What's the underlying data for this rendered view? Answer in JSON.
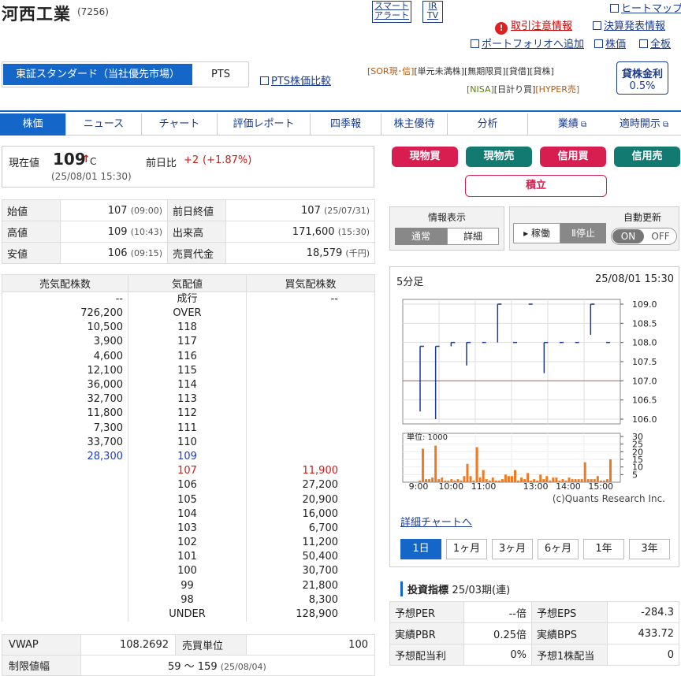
{
  "header": {
    "name": "河西工業",
    "code": "(7256)",
    "smart_alert": [
      "スマート",
      "アラート"
    ],
    "irtv": [
      "IR",
      "TV"
    ],
    "heatmap": "ヒートマップ",
    "caution": "取引注意情報",
    "earnings": "決算発表情報",
    "portfolio_add": "ポートフォリオへ追加",
    "stock_price": "株価",
    "full_board": "全板"
  },
  "market": {
    "active": "東証スタンダード（当社優先市場）",
    "pts": "PTS",
    "pts_compare": "PTS株価比較"
  },
  "tags": {
    "row1": [
      "[SOR現･信]",
      "[単元未満株]",
      "[無期限買]",
      "[貸借]",
      "[貸株]"
    ],
    "row2": [
      "[NISA]",
      "[日計り買]",
      "[HYPER売]"
    ]
  },
  "lending": {
    "label": "貸株金利",
    "rate": "0.5%"
  },
  "nav": [
    "株価",
    "ニュース",
    "チャート",
    "評価レポート",
    "四季報",
    "株主優待",
    "分析",
    "業績",
    "適時開示"
  ],
  "price": {
    "label": "現在値",
    "value": "109",
    "arrow": "↑",
    "flag": "C",
    "time": "(25/08/01 15:30)",
    "change_label": "前日比",
    "change": "+2",
    "change_pct": "(+1.87%)"
  },
  "ohlc": [
    {
      "l1": "始値",
      "v1": "107",
      "t1": "(09:00)",
      "l2": "前日終値",
      "v2": "107",
      "t2": "(25/07/31)"
    },
    {
      "l1": "高値",
      "v1": "109",
      "t1": "(10:43)",
      "l2": "出来高",
      "v2": "171,600",
      "t2": "(15:30)"
    },
    {
      "l1": "安値",
      "v1": "106",
      "t1": "(09:15)",
      "l2": "売買代金",
      "v2": "18,579",
      "t2": "(千円)"
    }
  ],
  "board": {
    "headers": [
      "売気配株数",
      "気配値",
      "買気配株数"
    ],
    "rows": [
      {
        "ask": "--",
        "price": "成行",
        "bid": "--"
      },
      {
        "ask": "726,200",
        "price": "OVER",
        "bid": ""
      },
      {
        "ask": "10,500",
        "price": "118",
        "bid": ""
      },
      {
        "ask": "3,900",
        "price": "117",
        "bid": ""
      },
      {
        "ask": "4,600",
        "price": "116",
        "bid": ""
      },
      {
        "ask": "12,100",
        "price": "115",
        "bid": ""
      },
      {
        "ask": "36,000",
        "price": "114",
        "bid": ""
      },
      {
        "ask": "32,700",
        "price": "113",
        "bid": ""
      },
      {
        "ask": "11,800",
        "price": "112",
        "bid": ""
      },
      {
        "ask": "7,300",
        "price": "111",
        "bid": ""
      },
      {
        "ask": "33,700",
        "price": "110",
        "bid": ""
      },
      {
        "ask": "28,300",
        "price": "109",
        "bid": ""
      },
      {
        "ask": "",
        "price": "107",
        "bid": "11,900"
      },
      {
        "ask": "",
        "price": "106",
        "bid": "27,200"
      },
      {
        "ask": "",
        "price": "105",
        "bid": "20,900"
      },
      {
        "ask": "",
        "price": "104",
        "bid": "16,000"
      },
      {
        "ask": "",
        "price": "103",
        "bid": "6,700"
      },
      {
        "ask": "",
        "price": "102",
        "bid": "11,200"
      },
      {
        "ask": "",
        "price": "101",
        "bid": "50,400"
      },
      {
        "ask": "",
        "price": "100",
        "bid": "30,700"
      },
      {
        "ask": "",
        "price": "99",
        "bid": "21,800"
      },
      {
        "ask": "",
        "price": "98",
        "bid": "8,300"
      },
      {
        "ask": "",
        "price": "UNDER",
        "bid": "128,900"
      }
    ],
    "best_ask_color": "#1a3bd0",
    "best_bid_color": "#d01a1a"
  },
  "misc": {
    "vwap_label": "VWAP",
    "vwap": "108.2692",
    "unit_label": "売買単位",
    "unit": "100",
    "limit_label": "制限値幅",
    "limit": "59 ～ 159",
    "limit_date": "(25/08/04)"
  },
  "actions": {
    "spot_buy": "現物買",
    "spot_sell": "現物売",
    "margin_buy": "信用買",
    "margin_sell": "信用売",
    "accumulate": "積立"
  },
  "info_display": {
    "title": "情報表示",
    "normal": "通常",
    "detail": "詳細"
  },
  "auto_update": {
    "title": "自動更新",
    "run": "稼働",
    "stop": "停止",
    "on": "ON",
    "off": "OFF"
  },
  "chart": {
    "interval": "5分足",
    "datetime": "25/08/01 15:30",
    "credit": "(c)Quants Research Inc.",
    "detail_link": "詳細チャートへ",
    "ranges": [
      "1日",
      "1ヶ月",
      "3ヶ月",
      "6ヶ月",
      "1年",
      "3年"
    ]
  },
  "chart_data": {
    "type": "line",
    "price_ticks": [
      "109.0",
      "108.5",
      "108.0",
      "107.5",
      "107.0",
      "106.5",
      "106.0"
    ],
    "ylim": [
      106.0,
      109.0
    ],
    "prev_close": 107.0,
    "volume_label": "単位: 1000",
    "volume_ticks": [
      "30",
      "25",
      "20",
      "15",
      "10",
      "5"
    ],
    "volume_ylim": [
      0,
      30
    ],
    "x_ticks": [
      "9:00",
      "10:00",
      "11:00",
      "13:00",
      "14:00",
      "15:00"
    ],
    "price_segments": [
      [
        106.2,
        107.9
      ],
      [
        106.0,
        107.9
      ],
      [
        107.9,
        108.0
      ],
      [
        107.4,
        108.0
      ],
      [
        108.0,
        108.0
      ],
      [
        108.0,
        109.0
      ],
      [
        108.0,
        108.0
      ],
      [
        109.0,
        109.0
      ],
      [
        107.2,
        108.0
      ],
      [
        108.0,
        108.0
      ],
      [
        108.0,
        108.0
      ],
      [
        108.2,
        109.0
      ],
      [
        108.0,
        108.0
      ]
    ],
    "volumes": [
      1,
      22,
      2,
      2,
      3,
      24,
      2,
      3,
      1,
      1,
      2,
      1,
      2,
      1,
      4,
      12,
      4,
      1,
      23,
      3,
      8,
      2,
      1,
      3,
      1,
      1,
      2,
      5,
      4,
      4,
      8,
      1,
      3,
      2,
      6,
      1,
      2,
      1,
      5,
      2,
      4,
      1,
      3,
      3,
      1,
      2,
      1,
      3,
      2,
      2,
      2,
      2,
      13,
      2,
      2,
      2,
      4,
      1,
      1,
      2,
      15
    ]
  },
  "indicators": {
    "title": "投資指標",
    "period": "25/03期(連)",
    "rows": [
      {
        "l1": "予想PER",
        "v1": "--倍",
        "l2": "予想EPS",
        "v2": "-284.3"
      },
      {
        "l1": "実績PBR",
        "v1": "0.25倍",
        "l2": "実績BPS",
        "v2": "433.72"
      },
      {
        "l1": "予想配当利",
        "v1": "0%",
        "l2": "予想1株配当",
        "v2": "0"
      }
    ]
  },
  "colors": {
    "accent": "#1467c8",
    "buy": "#d81e50",
    "sell": "#127a70",
    "up": "#d01a1a",
    "chart_line": "#1a3b8f",
    "volume_bar": "#f07820"
  }
}
